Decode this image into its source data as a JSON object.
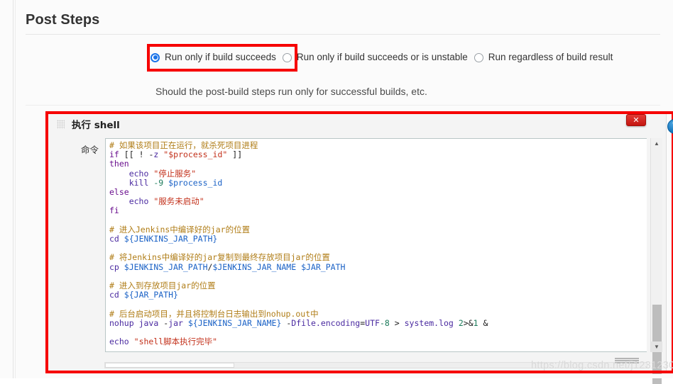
{
  "page": {
    "section_title": "Post Steps",
    "description": "Should the post-build steps run only for successful builds, etc.",
    "watermark": "https://blog.csdn.net/j1231230"
  },
  "radio_group": {
    "name": "post-steps-run-condition",
    "selected_index": 0,
    "options": [
      {
        "label": "Run only if build succeeds",
        "checked": true
      },
      {
        "label": "Run only if build succeeds or is unstable",
        "checked": false
      },
      {
        "label": "Run regardless of build result",
        "checked": false
      }
    ]
  },
  "builder": {
    "title": "执行 shell",
    "grip_icon": "drag-handle-icon",
    "close_icon": "✕",
    "help_icon": "?",
    "command_label": "命令",
    "code": "# 如果该项目正在运行，就杀死项目进程\nif [[ ! -z \"$process_id\" ]]\nthen\n    echo \"停止服务\"\n    kill -9 $process_id\nelse\n    echo \"服务未启动\"\nfi\n\n# 进入Jenkins中编译好的jar的位置\ncd ${JENKINS_JAR_PATH}\n\n# 将Jenkins中编译好的jar复制到最终存放项目jar的位置\ncp $JENKINS_JAR_PATH/$JENKINS_JAR_NAME $JAR_PATH\n\n# 进入到存放项目jar的位置\ncd ${JAR_PATH}\n\n# 后台启动项目，并且将控制台日志输出到nohup.out中\nnohup java -jar ${JENKINS_JAR_NAME} -Dfile.encoding=UTF-8 > system.log 2>&1 &\n\necho \"shell脚本执行完毕\"",
    "code_lines": [
      {
        "type": "comment",
        "text": "# 如果该项目正在运行，就杀死项目进程"
      },
      {
        "type": "code",
        "text": "if [[ ! -z \"$process_id\" ]]"
      },
      {
        "type": "code",
        "text": "then"
      },
      {
        "type": "code",
        "text": "    echo \"停止服务\""
      },
      {
        "type": "code",
        "text": "    kill -9 $process_id"
      },
      {
        "type": "code",
        "text": "else"
      },
      {
        "type": "code",
        "text": "    echo \"服务未启动\""
      },
      {
        "type": "code",
        "text": "fi"
      },
      {
        "type": "blank",
        "text": ""
      },
      {
        "type": "comment",
        "text": "# 进入Jenkins中编译好的jar的位置"
      },
      {
        "type": "code",
        "text": "cd ${JENKINS_JAR_PATH}"
      },
      {
        "type": "blank",
        "text": ""
      },
      {
        "type": "comment",
        "text": "# 将Jenkins中编译好的jar复制到最终存放项目jar的位置"
      },
      {
        "type": "code",
        "text": "cp $JENKINS_JAR_PATH/$JENKINS_JAR_NAME $JAR_PATH"
      },
      {
        "type": "blank",
        "text": ""
      },
      {
        "type": "comment",
        "text": "# 进入到存放项目jar的位置"
      },
      {
        "type": "code",
        "text": "cd ${JAR_PATH}"
      },
      {
        "type": "blank",
        "text": ""
      },
      {
        "type": "comment",
        "text": "# 后台启动项目，并且将控制台日志输出到nohup.out中"
      },
      {
        "type": "code",
        "text": "nohup java -jar ${JENKINS_JAR_NAME} -Dfile.encoding=UTF-8 > system.log 2>&1 &"
      },
      {
        "type": "blank",
        "text": ""
      },
      {
        "type": "code",
        "text": "echo \"shell脚本执行完毕\""
      }
    ],
    "scrollbar": {
      "up_arrow": "▲",
      "down_arrow": "▼"
    }
  },
  "colors": {
    "highlight_box": "#f60000",
    "radio_selected": "#1a73e8",
    "comment": "#b07d17",
    "keyword": "#6a0f8e",
    "variable": "#1b62c6",
    "string": "#c3311b",
    "close_button": "#c41610",
    "help_button": "#0d6fb8"
  }
}
